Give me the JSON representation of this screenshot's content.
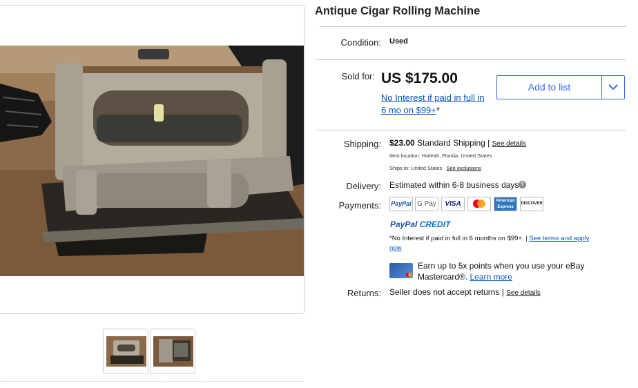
{
  "listing": {
    "title": "Antique Cigar Rolling Machine",
    "condition_label": "Condition:",
    "condition_value": "Used",
    "sold_label": "Sold for:",
    "price": "US $175.00",
    "interest_line1": "No Interest if paid in full in",
    "interest_line2": "6 mo on $99+",
    "interest_asterisk": "*",
    "add_to_list": "Add to list"
  },
  "shipping": {
    "label": "Shipping:",
    "cost": "$23.00",
    "method": "Standard Shipping",
    "separator": "|",
    "details_link": "See details",
    "item_location": "Item location:  Hialeah, Florida, United States",
    "ships_to": "Ships to:  United States",
    "exclusions_link": "See exclusions"
  },
  "delivery": {
    "label": "Delivery:",
    "text": "Estimated within 6-8 business days",
    "help_glyph": "?"
  },
  "payments": {
    "label": "Payments:",
    "methods": [
      "PayPal",
      "G Pay",
      "VISA",
      "Mastercard",
      "American Express",
      "DISCOVER"
    ],
    "paypal_credit_pay": "PayPal",
    "paypal_credit_word": "CREDIT",
    "credit_terms_a": "*No Interest if paid in full in 6 months on $99+.",
    "credit_terms_sep": "|",
    "credit_terms_link_a": "See terms and apply",
    "credit_terms_link_b": "now",
    "mastercard_promo_a": "Earn up to 5x points when you use your eBay",
    "mastercard_promo_b": "Mastercard®.",
    "learn_more": "Learn more"
  },
  "returns": {
    "label": "Returns:",
    "text": "Seller does not accept returns",
    "separator": "|",
    "details_link": "See details"
  },
  "colors": {
    "link": "#0654ba",
    "button_blue": "#3665f3",
    "divider": "#cccccc"
  }
}
